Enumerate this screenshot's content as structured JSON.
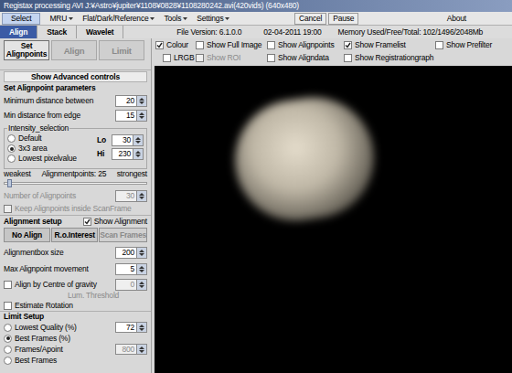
{
  "window": {
    "title": "Registax processing AVI J:¥Astro¥jupiter¥1108¥0828¥1108280242.avi(420vids) (640x480)"
  },
  "menu_bar": {
    "select": {
      "label": "Select",
      "selected": true
    },
    "menus": [
      "MRU",
      "Flat/Dark/Reference",
      "Tools",
      "Settings"
    ],
    "cancel": "Cancel",
    "pause": "Pause",
    "about": "About"
  },
  "tabs": [
    {
      "label": "Align",
      "selected": true
    },
    {
      "label": "Stack",
      "selected": false
    },
    {
      "label": "Wavelet",
      "selected": false
    }
  ],
  "info": {
    "file_version": "File Version: 6.1.0.0",
    "date": "02-04-2011 19:00",
    "memory": "Memory Used/Free/Total: 102/1496/2048Mb"
  },
  "mode_buttons": [
    {
      "label": "Set Alignpoints",
      "selected": true,
      "disabled": false
    },
    {
      "label": "Align",
      "selected": false,
      "disabled": true
    },
    {
      "label": "Limit",
      "selected": false,
      "disabled": true
    }
  ],
  "display_options": [
    {
      "label": "Colour",
      "checked": true,
      "disabled": false
    },
    {
      "label": "Show Full Image",
      "checked": false,
      "disabled": false
    },
    {
      "label": "Show Alignpoints",
      "checked": false,
      "disabled": false
    },
    {
      "label": "Show Framelist",
      "checked": true,
      "disabled": false
    },
    {
      "label": "Show Prefilter",
      "checked": false,
      "disabled": false
    },
    {
      "label": "LRGB",
      "checked": false,
      "disabled": false
    },
    {
      "label": "Show ROI",
      "checked": false,
      "disabled": true
    },
    {
      "label": "Show Aligndata",
      "checked": false,
      "disabled": false
    },
    {
      "label": "Show Registrationgraph",
      "checked": false,
      "disabled": false
    }
  ],
  "advanced": "Show Advanced controls",
  "alignpoint_params": {
    "heading": "Set Alignpoint parameters",
    "fields": [
      {
        "label": "Minimum distance between",
        "value": "20",
        "disabled": false
      },
      {
        "label": "Min distance from edge",
        "value": "15",
        "disabled": false
      }
    ]
  },
  "intensity": {
    "legend": "Intensity_selection",
    "options": [
      {
        "label": "Default",
        "selected": false
      },
      {
        "label": "3x3 area",
        "selected": true
      },
      {
        "label": "Lowest pixelvalue",
        "selected": false
      }
    ],
    "lo": {
      "label": "Lo",
      "value": "30"
    },
    "hi": {
      "label": "Hi",
      "value": "230"
    }
  },
  "alignpoints_slider": {
    "left": "weakest",
    "middle": "Alignmentpoints: 25",
    "right": "strongest",
    "level": 0.02
  },
  "number_of_alignpoints": {
    "label": "Number of Alignpoints",
    "value": "30",
    "disabled": true
  },
  "keep_inside": {
    "label": "Keep Alignpoints inside ScanFrame",
    "checked": false,
    "disabled": true
  },
  "alignment_setup": {
    "heading": "Alignment setup",
    "show": {
      "label": "Show Alignment",
      "checked": true
    },
    "buttons": [
      {
        "label": "No Align",
        "disabled": false
      },
      {
        "label": "R.o.Interest",
        "disabled": false
      },
      {
        "label": "Scan Frames",
        "disabled": true
      }
    ],
    "fields": [
      {
        "label": "Alignmentbox size",
        "value": "200",
        "disabled": false
      },
      {
        "label": "Max Alignpoint movement",
        "value": "5",
        "disabled": false
      }
    ],
    "centre": {
      "label": "Align by Centre of gravity",
      "checked": false,
      "value": "0",
      "disabled": true,
      "threshold": "Lum. Threshold"
    },
    "rotation": {
      "label": "Estimate Rotation",
      "checked": false
    }
  },
  "limit_setup": {
    "heading": "Limit Setup",
    "options": [
      {
        "label": "Lowest Quality (%)",
        "selected": false,
        "value": "72",
        "disabled": false
      },
      {
        "label": "Best Frames (%)",
        "selected": true
      },
      {
        "label": "Frames/Apoint",
        "selected": false,
        "value": "800",
        "disabled": true
      },
      {
        "label": "Best Frames",
        "selected": false
      }
    ]
  }
}
